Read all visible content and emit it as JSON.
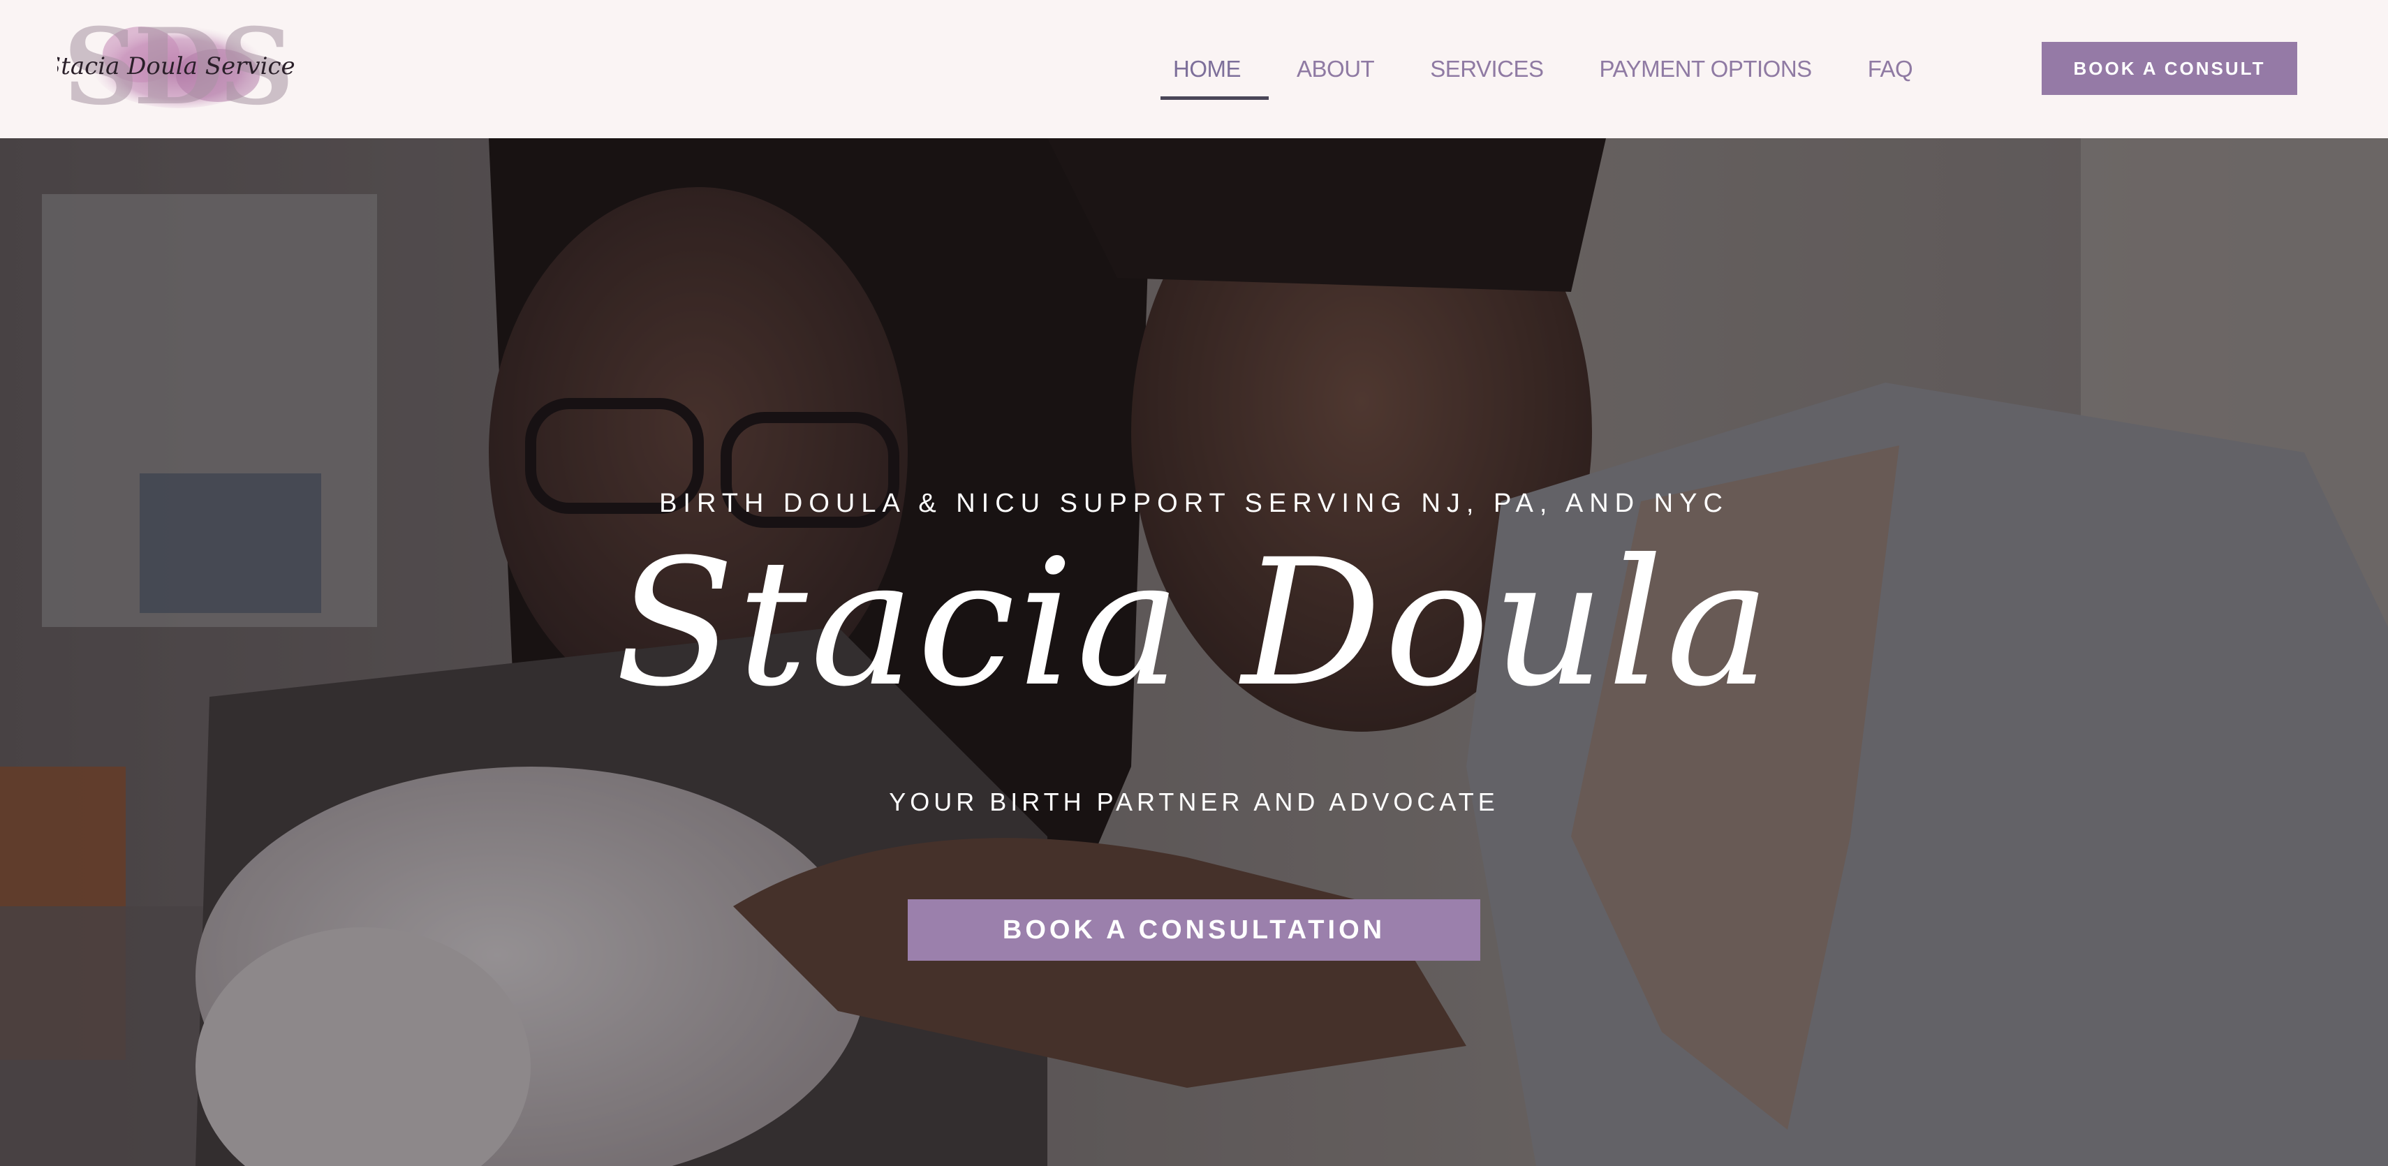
{
  "brand": {
    "logo_monogram": "SDS",
    "logo_script": "Stacia Doula Services"
  },
  "nav": {
    "items": [
      {
        "label": "HOME",
        "active": true
      },
      {
        "label": "ABOUT"
      },
      {
        "label": "SERVICES"
      },
      {
        "label": "PAYMENT OPTIONS"
      },
      {
        "label": "FAQ"
      }
    ],
    "cta_label": "BOOK A CONSULT"
  },
  "hero": {
    "tagline": "BIRTH DOULA & NICU SUPPORT SERVING NJ, PA, AND NYC",
    "title": "Stacia Doula",
    "subtitle": "YOUR BIRTH PARTNER AND ADVOCATE",
    "cta_label": "BOOK A CONSULTATION"
  },
  "colors": {
    "header_bg": "#faf4f4",
    "accent": "#957aa6",
    "nav_text": "#8f7aa3",
    "nav_underline": "#4a4658"
  }
}
